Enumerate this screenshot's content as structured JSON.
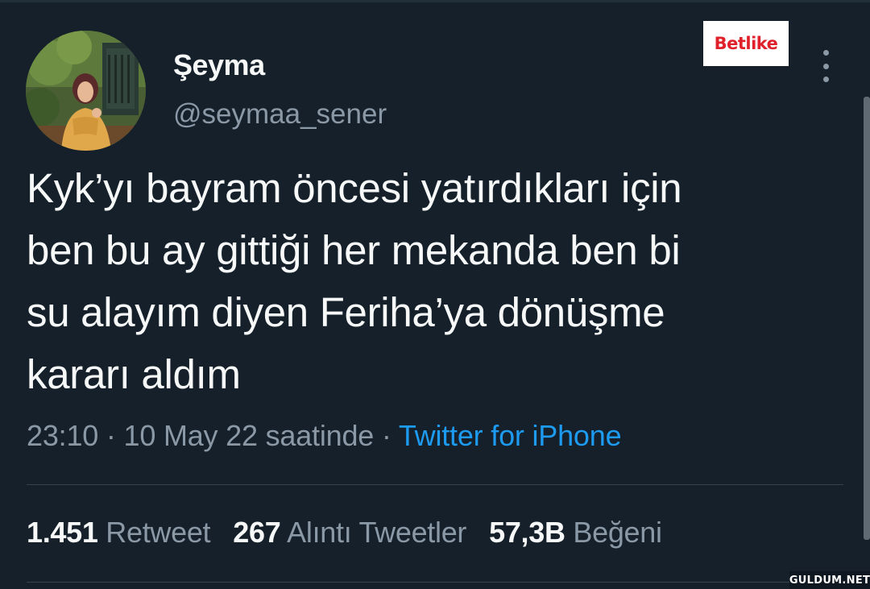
{
  "user": {
    "display_name": "Şeyma",
    "handle": "@seymaa_sener",
    "avatar_icon": "profile-photo"
  },
  "badge": {
    "text": "Betlike"
  },
  "menu": {
    "icon": "more-vertical-icon"
  },
  "tweet": {
    "lines": [
      "Kyk’yı bayram öncesi yatırdıkları için",
      "ben bu ay gittiği her mekanda ben bi",
      "su alayım diyen Feriha’ya dönüşme",
      "kararı aldım"
    ]
  },
  "meta": {
    "time": "23:10",
    "separator": " · ",
    "date": "10 May 22 saatinde",
    "source": "Twitter for iPhone"
  },
  "stats": {
    "retweets_count": "1.451",
    "retweets_label": "Retweet",
    "quotes_count": "267",
    "quotes_label": "Alıntı Tweetler",
    "likes_count": "57,3B",
    "likes_label": "Beğeni"
  },
  "footer": {
    "site_tag": "GULDUM.NET"
  },
  "colors": {
    "background": "#15202b",
    "text_primary": "#f7f9f9",
    "text_secondary": "#8b98a5",
    "link": "#1d9bf0",
    "divider": "#38444d"
  }
}
